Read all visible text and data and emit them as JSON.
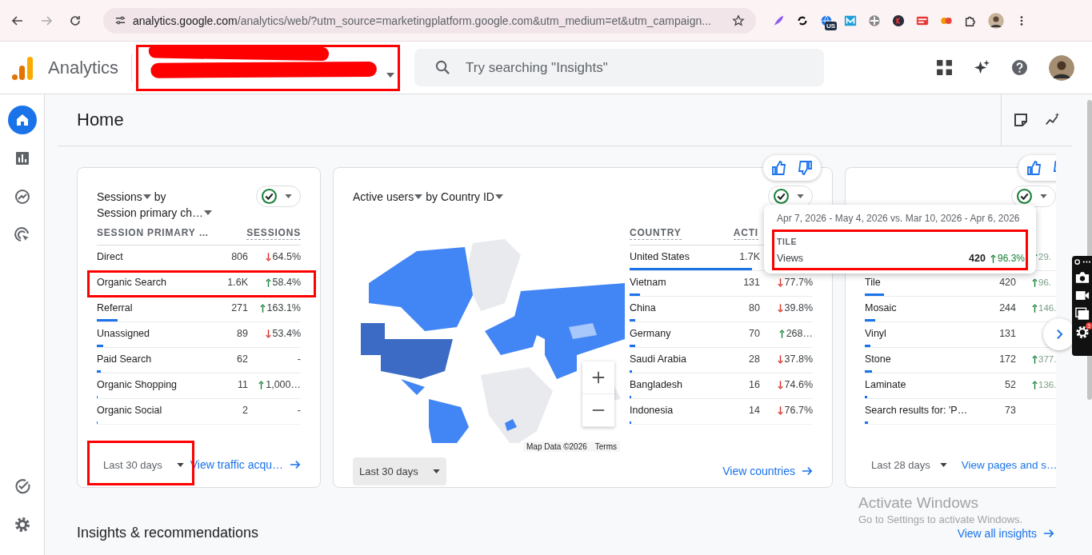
{
  "browser": {
    "url_host": "analytics.google.com",
    "url_path": "/analytics/web/?utm_source=marketingplatform.google.com&utm_medium=et&utm_campaign...",
    "extension_badge": "US"
  },
  "header": {
    "product": "Analytics",
    "account": {
      "redacted": true,
      "highlighted": true
    },
    "search": {
      "placeholder": "Try searching \"Insights\""
    }
  },
  "sidebar": {
    "items": [
      {
        "kind": "home",
        "selected": true
      },
      {
        "kind": "reports",
        "selected": false
      },
      {
        "kind": "explore",
        "selected": false
      },
      {
        "kind": "advertising",
        "selected": false
      }
    ],
    "bottom_items": [
      {
        "kind": "configure",
        "selected": false
      },
      {
        "kind": "admin",
        "selected": false
      }
    ]
  },
  "page": {
    "title": "Home"
  },
  "cards": [
    {
      "metric": "Sessions",
      "joiner": "by",
      "dimension": "Session primary ch…",
      "feedback": false,
      "clipped": false,
      "columns": [
        "SESSION PRIMARY …",
        "SESSIONS"
      ],
      "rows": [
        {
          "name": "Direct",
          "value": "806",
          "change": "64.5%",
          "up": false,
          "highlighted": false
        },
        {
          "name": "Organic Search",
          "value": "1.6K",
          "change": "58.4%",
          "up": true,
          "highlighted": true
        },
        {
          "name": "Referral",
          "value": "271",
          "change": "163.1%",
          "up": true,
          "level": 0.1,
          "highlighted": false
        },
        {
          "name": "Unassigned",
          "value": "89",
          "change": "53.4%",
          "up": false,
          "level": 0.03,
          "highlighted": false
        },
        {
          "name": "Paid Search",
          "value": "62",
          "change": "-",
          "level": 0.02,
          "highlighted": false
        },
        {
          "name": "Organic Shopping",
          "value": "11",
          "change": "1,000…",
          "up": true,
          "level": 0.005,
          "highlighted": false
        },
        {
          "name": "Organic Social",
          "value": "2",
          "change": "-",
          "level": 0.005,
          "highlighted": false
        }
      ],
      "date_range": {
        "label": "Last 30 days",
        "highlighted": true
      },
      "link": "View traffic acqu…"
    },
    {
      "metric": "Active users",
      "joiner": "by",
      "dimension": "Country ID",
      "feedback": true,
      "clipped": false,
      "map": {
        "kind": "picture",
        "attribution": "Map Data ©2026",
        "terms": "Terms"
      },
      "columns": [
        "COUNTRY",
        "ACTI"
      ],
      "rows": [
        {
          "name": "United States",
          "value": "1.7K",
          "level": 0.67,
          "highlighted": false
        },
        {
          "name": "Vietnam",
          "value": "131",
          "change": "77.7%",
          "up": false,
          "level": 0.055,
          "highlighted": false
        },
        {
          "name": "China",
          "value": "80",
          "change": "39.8%",
          "up": false,
          "level": 0.03,
          "highlighted": false
        },
        {
          "name": "Germany",
          "value": "70",
          "change": "268…",
          "up": true,
          "level": 0.03,
          "highlighted": false
        },
        {
          "name": "Saudi Arabia",
          "value": "28",
          "change": "37.8%",
          "up": false,
          "level": 0.013,
          "highlighted": false
        },
        {
          "name": "Bangladesh",
          "value": "16",
          "change": "74.6%",
          "up": false,
          "level": 0.01,
          "highlighted": false
        },
        {
          "name": "Indonesia",
          "value": "14",
          "change": "76.7%",
          "up": false,
          "level": 0.01,
          "highlighted": false
        }
      ],
      "date_range": {
        "label": "Last 30 days",
        "highlighted": false
      },
      "link": "View countries"
    },
    {
      "feedback": true,
      "clipped": true,
      "rows": [
        {
          "change": "29.",
          "up": true,
          "highlighted": false
        },
        {
          "name": "Tile",
          "value": "420",
          "change": "96.",
          "up": true,
          "level": 0.1,
          "highlighted": false
        },
        {
          "name": "Mosaic",
          "value": "244",
          "change": "146.",
          "up": true,
          "level": 0.055,
          "highlighted": false
        },
        {
          "name": "Vinyl",
          "value": "131",
          "level": 0.03,
          "highlighted": false
        },
        {
          "name": "Stone",
          "value": "172",
          "change": "377.",
          "up": true,
          "level": 0.037,
          "highlighted": false
        },
        {
          "name": "Laminate",
          "value": "52",
          "change": "136.",
          "up": true,
          "level": 0.012,
          "highlighted": false
        },
        {
          "name": "Search results for: 'P…",
          "value": "73",
          "level": 0.016,
          "highlighted": false
        }
      ],
      "date_range": {
        "label": "Last 28 days",
        "highlighted": false
      },
      "link": "View pages and s…"
    }
  ],
  "tooltip": {
    "dates": "Apr 7, 2026 - May 4, 2026 vs. Mar 10, 2026 - Apr 6, 2026",
    "label": "TILE",
    "metric": "Views",
    "value": "420",
    "change": "96.3%",
    "up": true,
    "highlighted": true
  },
  "insights": {
    "title": "Insights & recommendations",
    "link": "View all insights"
  },
  "os_overlay": {
    "title": "Activate Windows",
    "subtitle": "Go to Settings to activate Windows."
  },
  "recorder": {
    "badge": "3"
  }
}
